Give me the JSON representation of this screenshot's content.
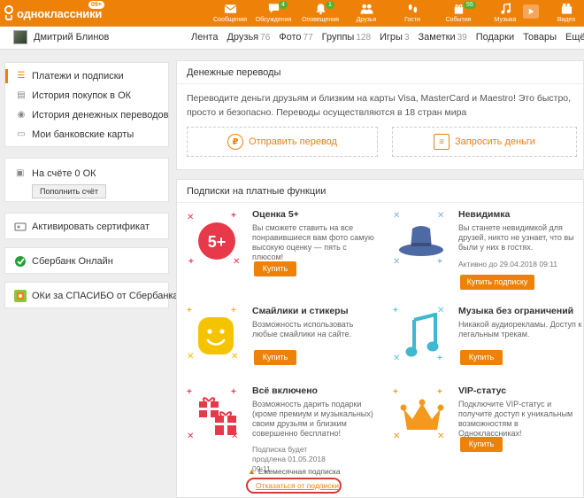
{
  "header": {
    "logo_text": "одноклассники",
    "logo_badge": "09+",
    "nav": [
      {
        "name": "messages",
        "label": "Сообщения",
        "icon": "envelope-icon",
        "badge": ""
      },
      {
        "name": "discussions",
        "label": "Обсуждения",
        "icon": "speech-bubble-icon",
        "badge": "4"
      },
      {
        "name": "notifications",
        "label": "Оповещения",
        "icon": "bell-icon",
        "badge": "1"
      },
      {
        "name": "friends",
        "label": "Друзья",
        "icon": "people-icon",
        "badge": ""
      },
      {
        "name": "guests",
        "label": "Гости",
        "icon": "footprints-icon",
        "badge": ""
      },
      {
        "name": "events",
        "label": "События",
        "icon": "events-icon",
        "badge": "55"
      },
      {
        "name": "music",
        "label": "Музыка",
        "icon": "music-note-icon",
        "badge": ""
      },
      {
        "name": "video-promo",
        "label": "",
        "icon": "play-icon",
        "badge": ""
      },
      {
        "name": "video",
        "label": "Видео",
        "icon": "video-camera-icon",
        "badge": ""
      }
    ]
  },
  "profile": {
    "name": "Дмитрий Блинов",
    "nav": [
      {
        "label": "Лента",
        "count": ""
      },
      {
        "label": "Друзья",
        "count": "76"
      },
      {
        "label": "Фото",
        "count": "77"
      },
      {
        "label": "Группы",
        "count": "128"
      },
      {
        "label": "Игры",
        "count": "3"
      },
      {
        "label": "Заметки",
        "count": "39"
      },
      {
        "label": "Подарки",
        "count": ""
      },
      {
        "label": "Товары",
        "count": ""
      },
      {
        "label": "Ещё ▼",
        "count": ""
      }
    ]
  },
  "sidebar": {
    "menu": [
      {
        "label": "Платежи и подписки",
        "icon": "list-icon",
        "active": true
      },
      {
        "label": "История покупок в ОК",
        "icon": "cart-icon",
        "active": false
      },
      {
        "label": "История денежных переводов",
        "icon": "coin-icon",
        "active": false
      },
      {
        "label": "Мои банковские карты",
        "icon": "card-icon",
        "active": false
      }
    ],
    "balance_label": "На счёте 0 ОК",
    "topup_label": "Пополнить счёт",
    "certificate_label": "Активировать сертификат",
    "sberbank_label": "Сбербанк Онлайн",
    "spasibo_label": "ОКи за СПАСИБО от Сбербанка"
  },
  "transfers": {
    "title": "Денежные переводы",
    "description": "Переводите деньги друзьям и близким на карты Visa, MasterCard и Maestro! Это быстро, просто и безопасно. Переводы осуществляются в 18 стран мира",
    "send_label": "Отправить перевод",
    "request_label": "Запросить деньги"
  },
  "subscriptions": {
    "title": "Подписки на платные функции",
    "features": [
      {
        "title": "Оценка 5+",
        "desc": "Вы сможете ставить на все понравившиеся вам фото самую высокую оценку — пять с плюсом!",
        "button": "Купить",
        "note": "",
        "art_text": "5+"
      },
      {
        "title": "Невидимка",
        "desc": "Вы станете невидимкой для друзей, никто не узнает, что вы были у них в гостях.",
        "button": "Купить подписку",
        "note": "Активно до 29.04.2018 09:11",
        "art_text": ""
      },
      {
        "title": "Смайлики и стикеры",
        "desc": "Возможность использовать любые смайлики на сайте.",
        "button": "Купить",
        "note": "",
        "art_text": ""
      },
      {
        "title": "Музыка без ограничений",
        "desc": "Никакой аудиорекламы. Доступ к легальным трекам.",
        "button": "Купить",
        "note": "",
        "art_text": ""
      },
      {
        "title": "Всё включено",
        "desc": "Возможность дарить подарки (кроме премиум и музыкальных) своим друзьям и близким совершенно бесплатно!",
        "button": "",
        "note": "Подписка будет продлена 01.05.2018 09:11",
        "art_text": ""
      },
      {
        "title": "VIP-статус",
        "desc": "Подключите VIP-статус и получите доступ к уникальным возможностям в Одноклассниках!",
        "button": "Купить",
        "note": "",
        "art_text": ""
      }
    ],
    "monthly_label": "Ежемесячная подписка",
    "cancel_label": "Отказаться от подписки"
  },
  "colors": {
    "brand": "#ee8208",
    "highlight_ring": "#d43a3a"
  }
}
